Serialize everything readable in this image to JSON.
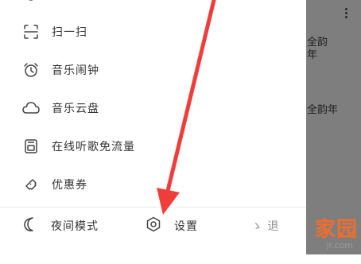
{
  "background_app": {
    "text_1": "全韵",
    "text_2": "年",
    "text_3": "全韵年",
    "menu_icon": "more-vertical-icon"
  },
  "drawer": {
    "items": [
      {
        "label": "",
        "icon": "partial-icon"
      },
      {
        "label": "扫一扫",
        "icon": "scan-icon"
      },
      {
        "label": "音乐闹钟",
        "icon": "alarm-clock-icon"
      },
      {
        "label": "音乐云盘",
        "icon": "cloud-icon"
      },
      {
        "label": "在线听歌免流量",
        "icon": "data-card-icon"
      },
      {
        "label": "优惠券",
        "icon": "coupon-icon"
      }
    ]
  },
  "bottom_bar": {
    "night_mode": "夜间模式",
    "settings": "设置",
    "exit": "ゝ 退"
  },
  "watermark": {
    "main": "家园",
    "sub": "jr.com"
  },
  "colors": {
    "accent_red": "#ef3e3a",
    "watermark_orange": "#f06d2c",
    "dim_overlay": "#7e7e7e"
  }
}
